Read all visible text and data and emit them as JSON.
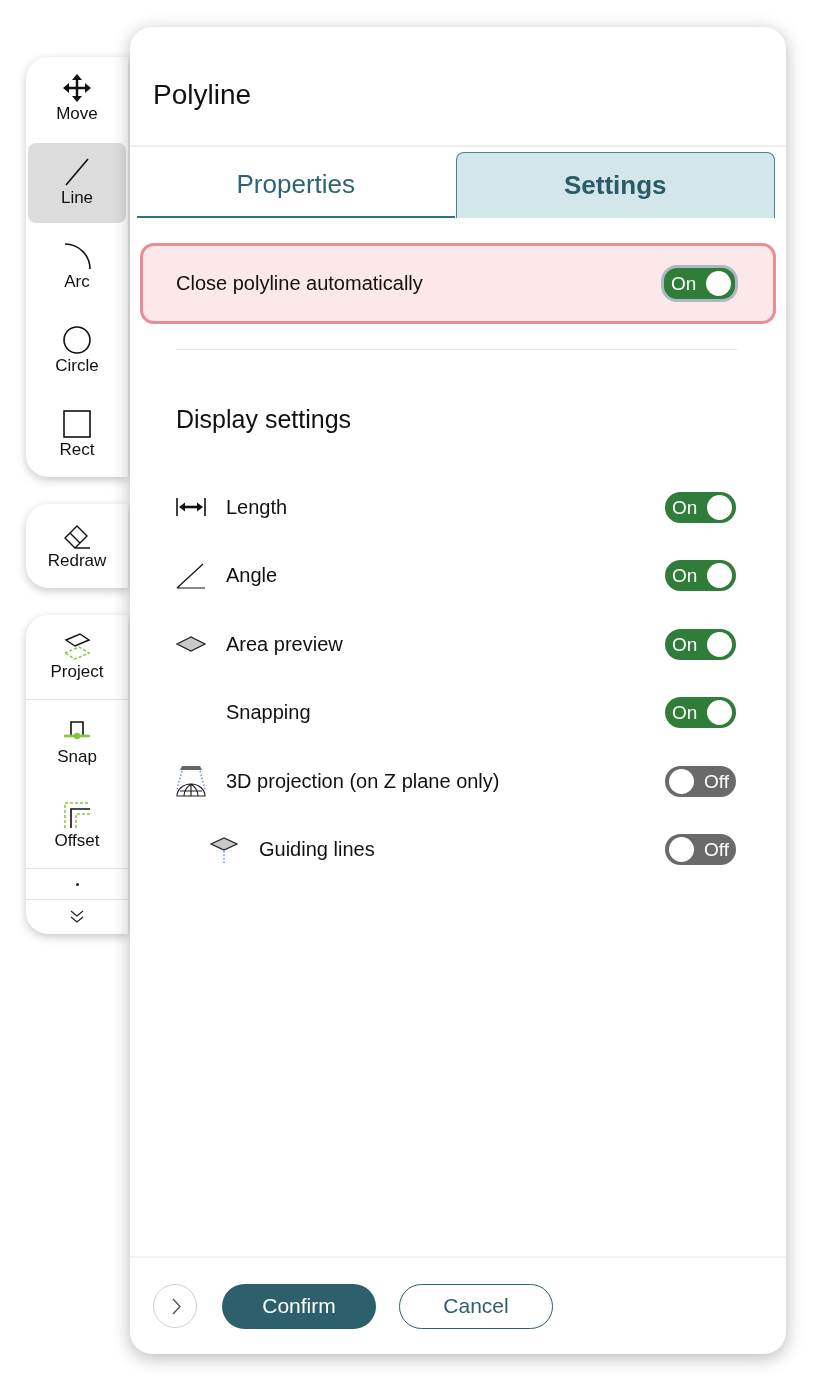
{
  "toolbar": {
    "groups": [
      {
        "sections": [
          {
            "items": [
              {
                "kind": "tool",
                "label": "Move",
                "selected": false
              },
              {
                "kind": "tool",
                "label": "Line",
                "selected": true
              },
              {
                "kind": "tool",
                "label": "Arc",
                "selected": false
              },
              {
                "kind": "tool",
                "label": "Circle",
                "selected": false
              },
              {
                "kind": "tool",
                "label": "Rect",
                "selected": false
              }
            ]
          }
        ]
      },
      {
        "sections": [
          {
            "items": [
              {
                "kind": "tool",
                "label": "Redraw",
                "selected": false
              }
            ]
          }
        ]
      },
      {
        "sections": [
          {
            "items": [
              {
                "kind": "tool",
                "label": "Project",
                "selected": false
              }
            ]
          },
          {
            "items": [
              {
                "kind": "tool",
                "label": "Snap",
                "selected": false
              },
              {
                "kind": "tool",
                "label": "Offset",
                "selected": false
              }
            ]
          },
          {
            "items": [
              {
                "kind": "stub",
                "selected": false
              }
            ]
          },
          {
            "items": [
              {
                "kind": "more",
                "selected": false
              }
            ]
          }
        ]
      }
    ]
  },
  "panel": {
    "title": "Polyline",
    "tabs": [
      {
        "label": "Properties",
        "selected": false
      },
      {
        "label": "Settings",
        "selected": true
      }
    ],
    "close_setting": {
      "label": "Close polyline automatically",
      "on": true,
      "value_text": "On",
      "highlighted": true,
      "focused": true
    },
    "section_title": "Display settings",
    "settings": [
      {
        "label": "Length",
        "on": true,
        "value_text": "On"
      },
      {
        "label": "Angle",
        "on": true,
        "value_text": "On"
      },
      {
        "label": "Area preview",
        "on": true,
        "value_text": "On"
      },
      {
        "label": "Snapping",
        "on": true,
        "value_text": "On"
      },
      {
        "label": "3D projection (on Z plane only)",
        "on": false,
        "value_text": "Off",
        "children": [
          {
            "label": "Guiding lines",
            "on": false,
            "value_text": "Off"
          }
        ]
      }
    ],
    "footer": {
      "buttons": [
        {
          "kind": "next"
        },
        {
          "kind": "primary",
          "label": "Confirm"
        },
        {
          "kind": "secondary",
          "label": "Cancel"
        }
      ]
    }
  }
}
